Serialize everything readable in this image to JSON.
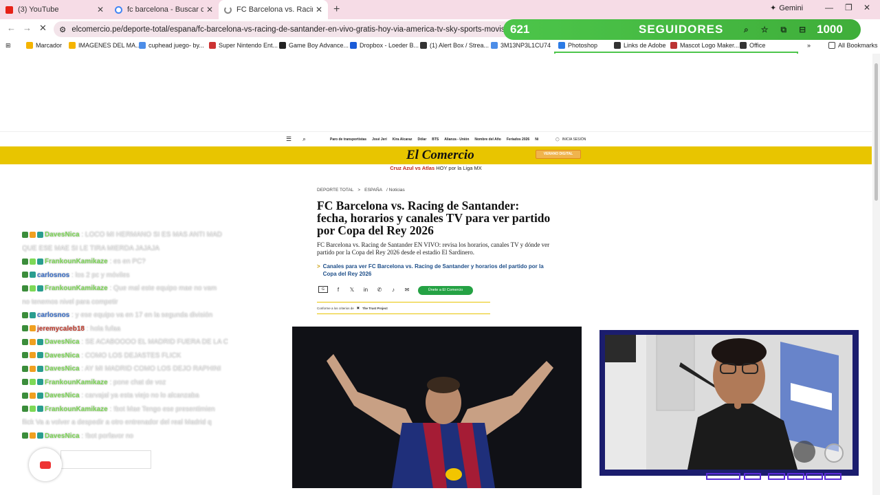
{
  "browser": {
    "tabs": [
      {
        "title": "(3) YouTube",
        "icon": "youtube-icon",
        "active": false
      },
      {
        "title": "fc barcelona - Buscar con Goog",
        "icon": "google-icon",
        "active": false
      },
      {
        "title": "FC Barcelona vs. Racing de Sant",
        "icon": "loading-icon",
        "active": true
      }
    ],
    "new_tab": "+",
    "gemini_label": "Gemini",
    "url": "elcomercio.pe/deporte-total/espana/fc-barcelona-vs-racing-de-santander-en-vivo-gratis-hoy-via-america-tv-sky-sports-movistar-plus-horarios-canales-",
    "bookmarks": [
      {
        "label": "Marcador",
        "color": "#f5b400"
      },
      {
        "label": "IMAGENES DEL MA...",
        "color": "#f5b400"
      },
      {
        "label": "cuphead juego- by...",
        "color": "#4c8de8"
      },
      {
        "label": "Super Nintendo Ent...",
        "color": "#c33"
      },
      {
        "label": "Game Boy Advance...",
        "color": "#222"
      },
      {
        "label": "Dropbox - Loeder B...",
        "color": "#1a5bd8"
      },
      {
        "label": "(1) Alert Box / Strea...",
        "color": "#333"
      },
      {
        "label": "3M13NP3L1CU74",
        "color": "#4c8de8"
      },
      {
        "label": "Photoshop",
        "color": "#2c7be5"
      },
      {
        "label": "Links de Adobe",
        "color": "#333"
      },
      {
        "label": "Mascot Logo Maker...",
        "color": "#b33"
      },
      {
        "label": "Office",
        "color": "#333"
      }
    ],
    "all_bookmarks": "All Bookmarks"
  },
  "overlay": {
    "current_followers": "621",
    "label": "SEGUIDORES",
    "goal": "1000"
  },
  "site": {
    "nav_links": [
      "Paro de transportistas",
      "José Jerí",
      "Kira Alcaraz",
      "Dólar",
      "BTS",
      "Alianza - Unión",
      "Nombre del Año",
      "Feriados 2026",
      "Ni"
    ],
    "login": "INICIA SESIÓN",
    "logo": "El Comercio",
    "promo_badge": "VERANO DIGITAL",
    "promo_highlight": "Cruz Azul vs Atlas",
    "promo_text": "HOY por la Liga MX"
  },
  "article": {
    "breadcrumb": [
      "DEPORTE TOTAL",
      ">",
      "ESPAÑA",
      "/ Noticias"
    ],
    "headline": "FC Barcelona vs. Racing de Santander: fecha, horarios y canales TV para ver partido por Copa del Rey 2026",
    "subhead": "FC Barcelona vs. Racing de Santander EN VIVO: revisa los horarios, canales TV y dónde ver partido por la Copa del Rey 2026 desde el estadio El Sardinero.",
    "related_link": "Canales para ver FC Barcelona vs. Racing de Santander y horarios del partido por la Copa del Rey 2026",
    "whatsapp_button": "Únete a El Comercio",
    "trust_text": "Conforme a los criterios de",
    "trust_project": "The Trust Project"
  },
  "chat": {
    "messages": [
      {
        "user": "DavesNica",
        "text": ": LOCO MI HERMANO SI ES MAS ANTI MAD",
        "color": "#7ed957"
      },
      {
        "user": "",
        "text": "QUE ESE MAE SI LE TIRA MIERDA JAJAJA",
        "color": "#7ed957"
      },
      {
        "user": "FrankounKamikaze",
        "text": ": es en PC?",
        "color": "#7ed957"
      },
      {
        "user": "carlosnos",
        "text": ": los 2 pc y móviles",
        "color": "#3a6fc8"
      },
      {
        "user": "FrankounKamikaze",
        "text": ": Que mal este equipo mae no vam",
        "color": "#7ed957"
      },
      {
        "user": "",
        "text": "no tenemos nivel para competir",
        "color": "#7ed957"
      },
      {
        "user": "carlosnos",
        "text": ": y ese equipo va en 17 en la segunda división",
        "color": "#3a6fc8"
      },
      {
        "user": "jeremycaleb18",
        "text": ": hola fufaa",
        "color": "#c0392b"
      },
      {
        "user": "DavesNica",
        "text": ": SE ACABOOOO EL MADRID FUERA DE LA C",
        "color": "#7ed957"
      },
      {
        "user": "DavesNica",
        "text": ": COMO LOS DEJASTES FLICK",
        "color": "#7ed957"
      },
      {
        "user": "DavesNica",
        "text": ": AY MI MADRID COMO LOS DEJO RAPHINI",
        "color": "#7ed957"
      },
      {
        "user": "FrankounKamikaze",
        "text": ": pone chat de voz",
        "color": "#7ed957"
      },
      {
        "user": "DavesNica",
        "text": ": carvajal ya esta viejo no lo alcanzaba",
        "color": "#7ed957"
      },
      {
        "user": "FrankounKamikaze",
        "text": ": !bot Mae Tengo ese presentimien",
        "color": "#7ed957"
      },
      {
        "user": "",
        "text": "flick Va a volver a despedir a otro entrenador del real Madrid q",
        "color": "#7ed957"
      },
      {
        "user": "DavesNica",
        "text": ": !bot porfavor no",
        "color": "#7ed957"
      }
    ]
  }
}
